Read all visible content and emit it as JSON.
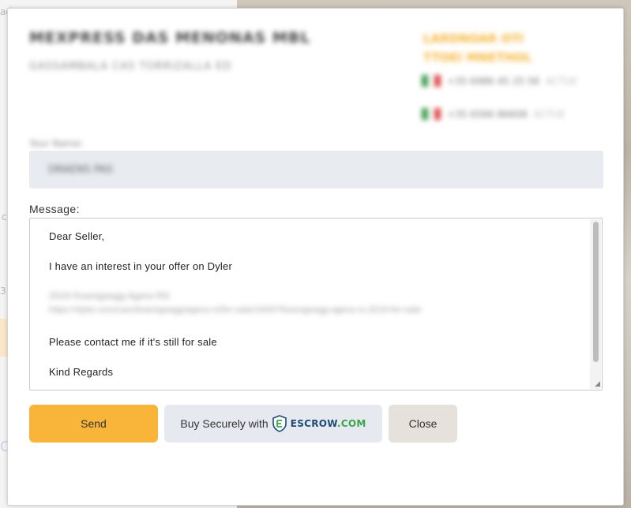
{
  "background": {
    "fragments": [
      "ad",
      "c",
      "3",
      "C"
    ]
  },
  "seller": {
    "name": "MEXPRESS DAS MENONAS MBL",
    "subtitle": "GASSAMBALA CAS TORRIZALLA ED"
  },
  "contact": {
    "title_line1": "LARDNOAR OTI",
    "title_line2": "TTOEI MNETHOL",
    "phones": [
      {
        "number": "+35 6986 45 25 58",
        "extra": "ACTUE"
      },
      {
        "number": "+35 6566 86608",
        "extra": "ACTUE"
      }
    ]
  },
  "name_field": {
    "label": "Your Name:",
    "value": "DRAENS PAS"
  },
  "message": {
    "label": "Message:",
    "lines": {
      "greeting": "Dear Seller,",
      "interest": "I have an interest in your offer on Dyler",
      "listing_title": "2019 Koenigsegg Agera RS",
      "listing_url": "https://dyler.com/cars/koenigsegg/agera-rs/for-sale/19097/koenigsegg-agera-rs-2019-for-sale",
      "request": "Please contact me if it's still for sale",
      "closing": "Kind Regards"
    }
  },
  "buttons": {
    "send": "Send",
    "escrow_prefix": "Buy Securely with",
    "escrow_brand": "ESCROW",
    "escrow_tld": ".COM",
    "close": "Close"
  },
  "colors": {
    "send": "#f9b53a",
    "escrow_bg": "#e6e9ef",
    "close_bg": "#e6e1db",
    "escrow_blue": "#1f4a78",
    "escrow_green": "#3aa64a"
  }
}
